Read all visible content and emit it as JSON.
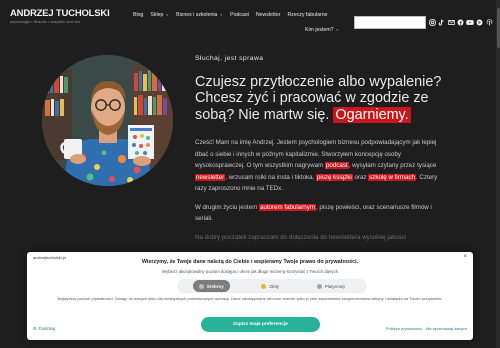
{
  "header": {
    "logo_name": "ANDRZEJ TUCHOLSKI",
    "logo_tagline": "psychologia • filozofia • wszystko pod oko",
    "nav": [
      "Blog",
      "Sklep",
      "Biznes i szkolenia",
      "Podcast",
      "Newsletter",
      "Rzeczy fabularne"
    ],
    "nav2": "Kim jestem?",
    "search_placeholder": ""
  },
  "hero": {
    "pre": "Słuchaj, jest sprawa",
    "headline": "Czujesz przytłoczenie albo wypalenie? Chcesz żyć i pracować w zgodzie ze sobą? Nie martw się.",
    "headline_highlight": "Ogarniemy.",
    "p1_a": "Cześć! Mam na imię Andrzej. Jestem psychologiem biznesu podpowiadającym jak lepiej dbać o siebie i innych w późnym kapitalizmie. Stworzyłem koncepcję osoby wysokosprawczej. O tym wszystkim nagrywam ",
    "p1_podcast": "podcast",
    "p1_b": ", wysyłam czytany przez tysiące ",
    "p1_newsletter": "newsletter",
    "p1_c": ", wrzucam rolki na insta i tiktoka, ",
    "p1_ksiazki": "piszę książki",
    "p1_d": " oraz ",
    "p1_szkole": "szkolę w firmach",
    "p1_e": ". Cztery razy zaproszono mnie na TEDx.",
    "p2_a": "W drugim życiu jestem ",
    "p2_mark": "autorem fabularnym",
    "p2_b": ", piszę powieści, oraz scenariusze filmów i seriali.",
    "p3": "Na dobry początek zapraszam do dołączenia do newslettera wysokiej jakości"
  },
  "cookie": {
    "site": "andrzejtucholski.pl",
    "title": "Wierzymy, że Twoje dane należą do Ciebie i wspieramy Twoje prawo do prywatności.",
    "subtitle": "Wybierz akceptowalny poziom dostępu i okres jak długo możemy korzystać z Twoich danych",
    "levels": [
      {
        "label": "Srebrny",
        "color": "#b7bcc2",
        "selected": true
      },
      {
        "label": "Złoty",
        "color": "#e2b43b",
        "selected": false
      },
      {
        "label": "Platynowy",
        "color": "#9aa7b3",
        "selected": false
      }
    ],
    "description": "Najwyższy poziom prywatności. Dostęp do danych tylko dla niezbędnych podstawowych operacji. Dane udostępniane stronom trzecim tylko w celu zapewnienia bezpieczeństwa witryny i działania na Twoim urządzeniu.",
    "save_button": "Zapisz moje preferencje",
    "customize": "Dostosuj",
    "links": "Polityka prywatności · Nie sprzedawaj danych"
  },
  "colors": {
    "accent_red": "#c9171b",
    "cookie_button": "#27b39a"
  }
}
